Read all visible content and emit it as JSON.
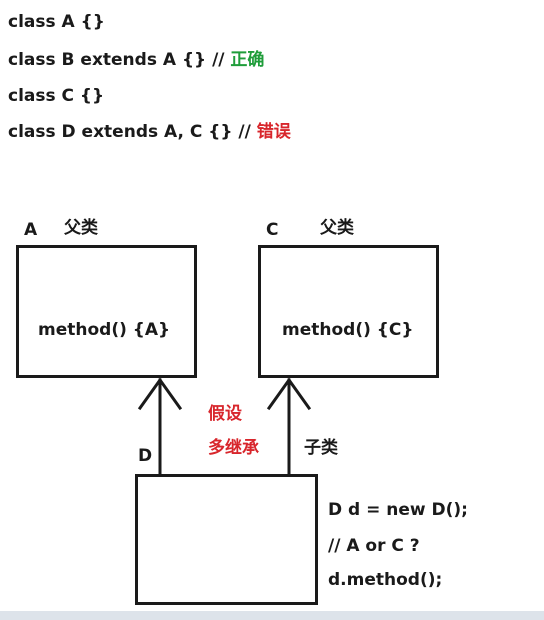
{
  "code": {
    "line1": "class A {}",
    "line2_code": "class B extends A {} // ",
    "line2_comment": "正确",
    "line3": "class C {}",
    "line4_code": "class D extends A, C {} // ",
    "line4_comment": "错误"
  },
  "diagram": {
    "a_name": "A",
    "a_role": "父类",
    "a_method": "method() {A}",
    "c_name": "C",
    "c_role": "父类",
    "c_method": "method() {C}",
    "d_name": "D",
    "d_role": "子类",
    "assume_line1": "假设",
    "assume_line2": "多继承",
    "note_line1": "D d = new D();",
    "note_line2": "// A or C ?",
    "note_line3": "d.method();"
  },
  "colors": {
    "correct": "#1f9d3a",
    "error": "#d8262c"
  }
}
